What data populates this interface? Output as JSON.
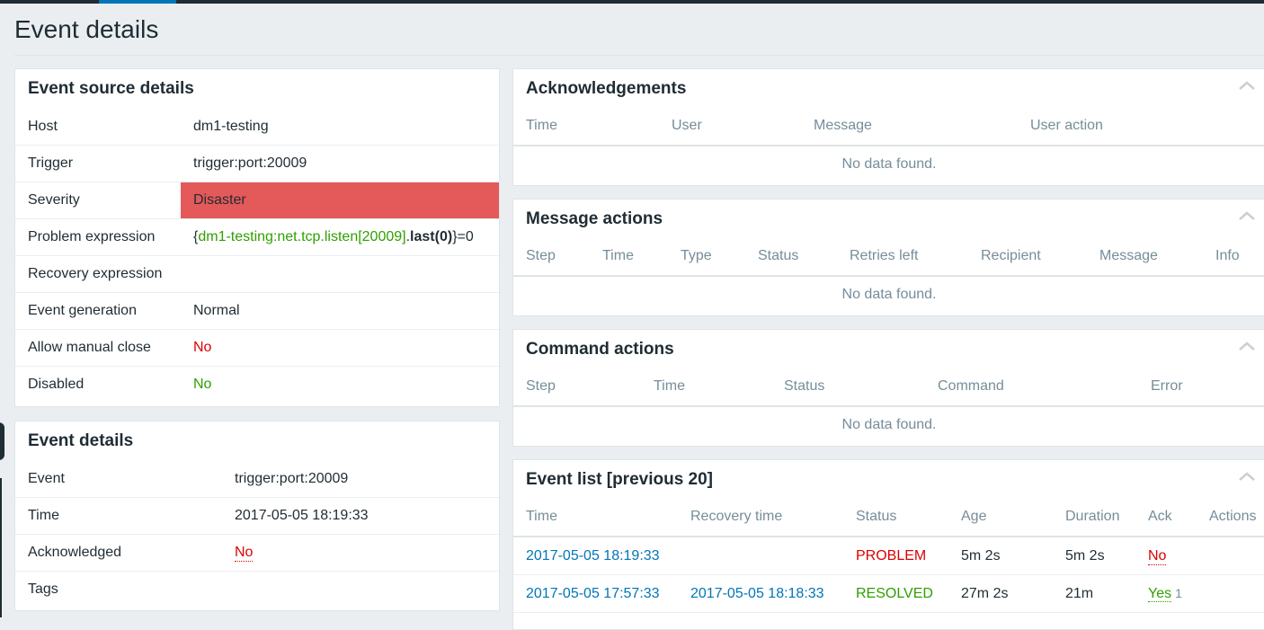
{
  "page_title": "Event details",
  "source_panel": {
    "title": "Event source details",
    "rows": [
      {
        "label": "Host",
        "value": "dm1-testing"
      },
      {
        "label": "Trigger",
        "value": "trigger:port:20009"
      },
      {
        "label": "Severity",
        "value": "Disaster"
      },
      {
        "label": "Problem expression",
        "expr_open": "{",
        "expr_host": "dm1-testing:net.tcp.listen[20009]",
        "expr_dot": ".",
        "expr_func": "last",
        "expr_arg": "(0)",
        "expr_close": "}=0"
      },
      {
        "label": "Recovery expression",
        "value": ""
      },
      {
        "label": "Event generation",
        "value": "Normal"
      },
      {
        "label": "Allow manual close",
        "value": "No"
      },
      {
        "label": "Disabled",
        "value": "No"
      }
    ],
    "severity_color": "#e45959"
  },
  "details_panel": {
    "title": "Event details",
    "rows": [
      {
        "label": "Event",
        "value": "trigger:port:20009"
      },
      {
        "label": "Time",
        "value": "2017-05-05 18:19:33"
      },
      {
        "label": "Acknowledged",
        "value": "No"
      },
      {
        "label": "Tags",
        "value": ""
      }
    ]
  },
  "ack_panel": {
    "title": "Acknowledgements",
    "columns": [
      "Time",
      "User",
      "Message",
      "User action"
    ],
    "empty": "No data found."
  },
  "message_panel": {
    "title": "Message actions",
    "columns": [
      "Step",
      "Time",
      "Type",
      "Status",
      "Retries left",
      "Recipient",
      "Message",
      "Info"
    ],
    "empty": "No data found."
  },
  "command_panel": {
    "title": "Command actions",
    "columns": [
      "Step",
      "Time",
      "Status",
      "Command",
      "Error"
    ],
    "empty": "No data found."
  },
  "event_list": {
    "title": "Event list [previous 20]",
    "columns": [
      "Time",
      "Recovery time",
      "Status",
      "Age",
      "Duration",
      "Ack",
      "Actions"
    ],
    "rows": [
      {
        "time": "2017-05-05 18:19:33",
        "recovery": "",
        "status": "PROBLEM",
        "age": "5m 2s",
        "duration": "5m 2s",
        "ack": "No",
        "ack_count": ""
      },
      {
        "time": "2017-05-05 17:57:33",
        "recovery": "2017-05-05 18:18:33",
        "status": "RESOLVED",
        "age": "27m 2s",
        "duration": "21m",
        "ack": "Yes",
        "ack_count": "1"
      }
    ]
  },
  "colors": {
    "accent": "#0275b8",
    "problem": "#dc0000",
    "resolved": "#2f9f00",
    "disaster": "#e45959"
  },
  "icons": {
    "collapse": "chevron-up-icon"
  }
}
